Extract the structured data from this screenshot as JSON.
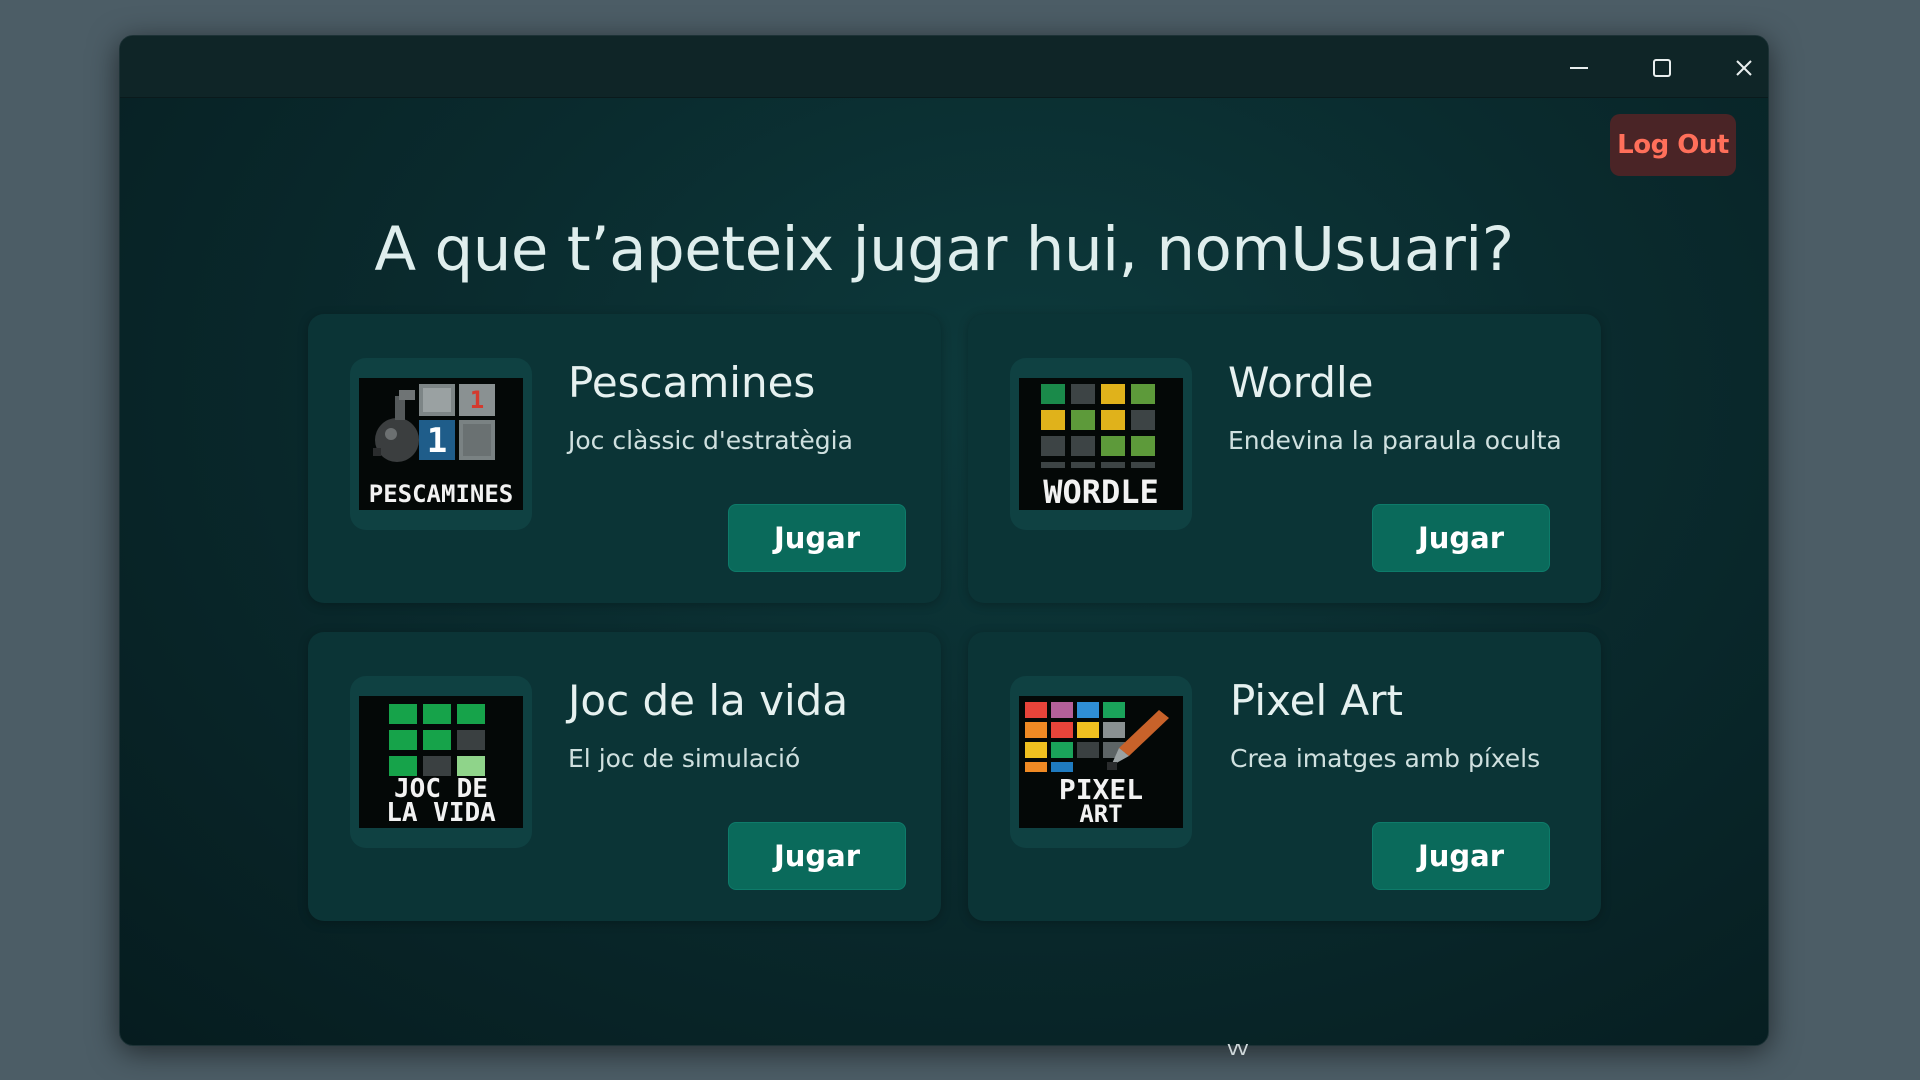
{
  "window": {
    "controls": {
      "minimize": "minimize-icon",
      "maximize": "maximize-icon",
      "close": "close-icon"
    },
    "logout_label": "Log Out"
  },
  "heading": "A que t’apeteix jugar hui, nomUsuari?",
  "games": [
    {
      "title": "Pescamines",
      "description": "Joc clàssic d'estratègia",
      "button": "Jugar",
      "icon_label": "PESCAMINES",
      "icon": "minesweeper-icon"
    },
    {
      "title": "Wordle",
      "description": "Endevina la paraula oculta",
      "button": "Jugar",
      "icon_label": "WORDLE",
      "icon": "wordle-icon"
    },
    {
      "title": "Joc de la vida",
      "description": "El joc de simulació",
      "button": "Jugar",
      "icon_label_line1": "JOC DE",
      "icon_label_line2": "LA VIDA",
      "icon": "game-of-life-icon"
    },
    {
      "title": "Pixel Art",
      "description": "Crea imatges amb píxels",
      "button": "Jugar",
      "icon_label_line1": "PIXEL",
      "icon_label_line2": "ART",
      "icon": "pixel-art-icon"
    }
  ],
  "footer_text": "vv",
  "colors": {
    "background": "#4c5d66",
    "window": "#0a2b2e",
    "card": "#0b3436",
    "button": "#0a6a5b",
    "logout_bg": "#4a2426",
    "logout_text": "#ff6f5a"
  }
}
